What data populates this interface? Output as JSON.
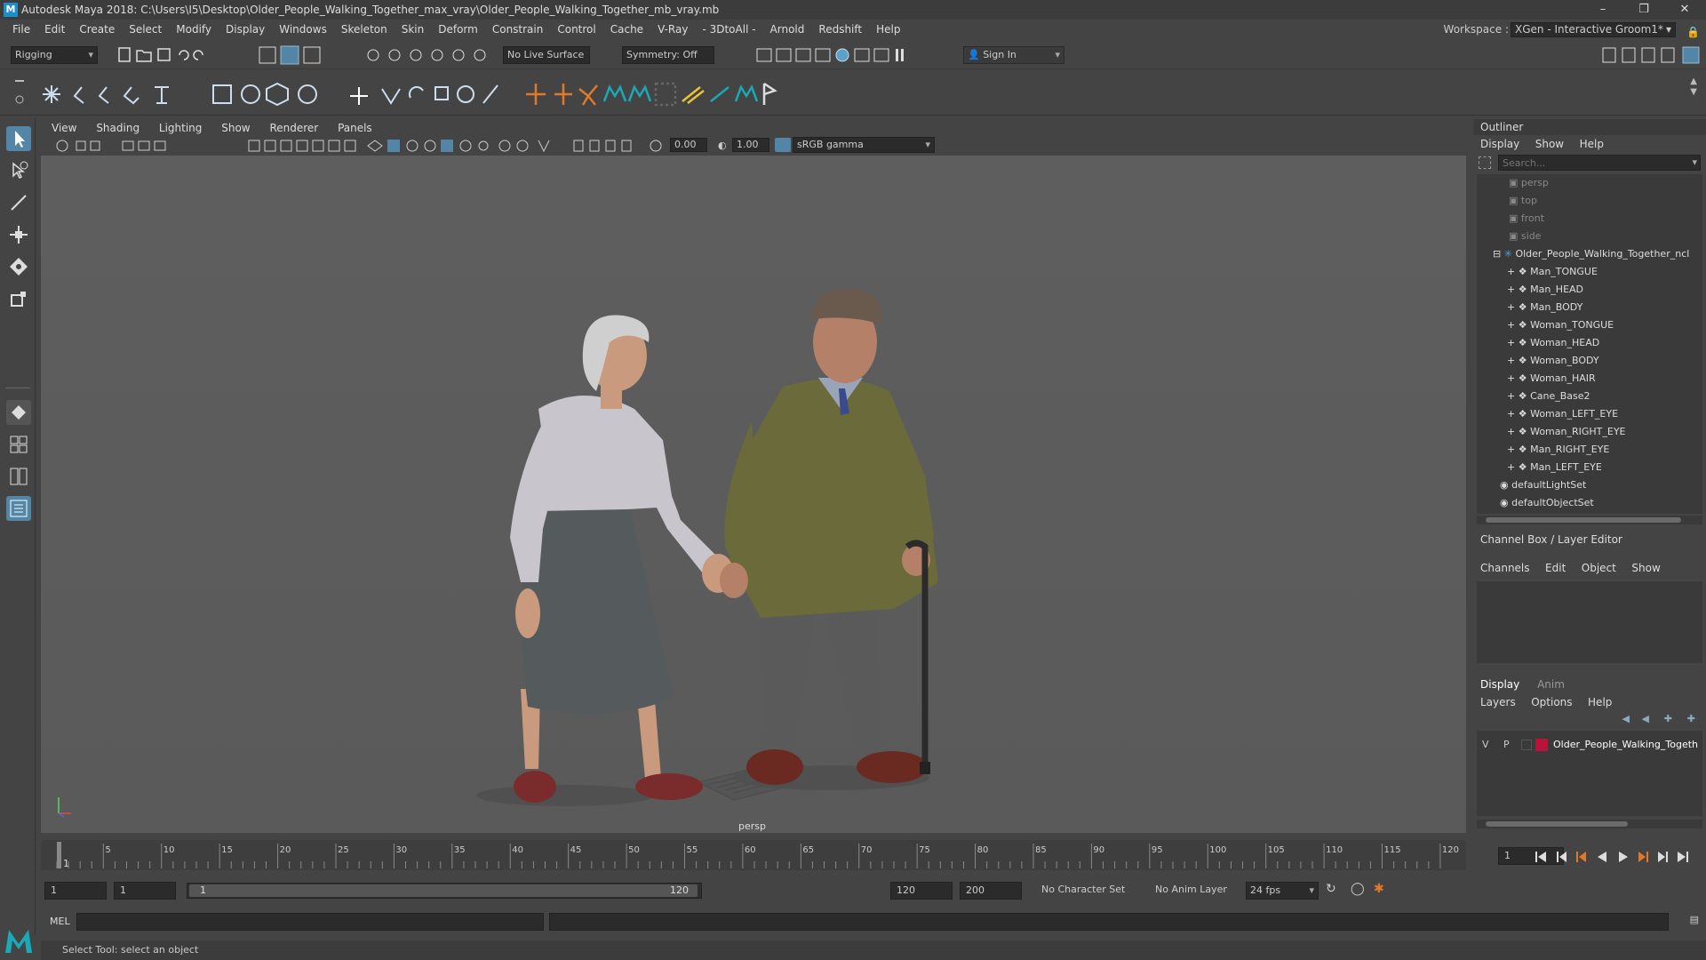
{
  "window": {
    "title": "Autodesk Maya 2018: C:\\Users\\I5\\Desktop\\Older_People_Walking_Together_max_vray\\Older_People_Walking_Together_mb_vray.mb",
    "logo": "M"
  },
  "menubar": {
    "items": [
      "File",
      "Edit",
      "Create",
      "Select",
      "Modify",
      "Display",
      "Windows",
      "Skeleton",
      "Skin",
      "Deform",
      "Constrain",
      "Control",
      "Cache",
      "V-Ray",
      "- 3DtoAll -",
      "Arnold",
      "Redshift",
      "Help"
    ],
    "workspace_label": "Workspace :",
    "workspace_value": "XGen - Interactive Groom1*"
  },
  "statusline": {
    "menuset": "Rigging",
    "live_surface": "No Live Surface",
    "symmetry": "Symmetry: Off",
    "sign_in": "Sign In"
  },
  "panel": {
    "menus": [
      "View",
      "Shading",
      "Lighting",
      "Show",
      "Renderer",
      "Panels"
    ],
    "exposure": "0.00",
    "gamma": "1.00",
    "colorspace": "sRGB gamma",
    "camera": "persp"
  },
  "outliner": {
    "title": "Outliner",
    "menus": [
      "Display",
      "Show",
      "Help"
    ],
    "search_placeholder": "Search...",
    "cameras": [
      "persp",
      "top",
      "front",
      "side"
    ],
    "group": "Older_People_Walking_Together_ncl",
    "children": [
      "Man_TONGUE",
      "Man_HEAD",
      "Man_BODY",
      "Woman_TONGUE",
      "Woman_HEAD",
      "Woman_BODY",
      "Woman_HAIR",
      "Cane_Base2",
      "Woman_LEFT_EYE",
      "Woman_RIGHT_EYE",
      "Man_RIGHT_EYE",
      "Man_LEFT_EYE"
    ],
    "sets": [
      "defaultLightSet",
      "defaultObjectSet"
    ]
  },
  "channelbox": {
    "title": "Channel Box / Layer Editor",
    "menus": [
      "Channels",
      "Edit",
      "Object",
      "Show"
    ]
  },
  "layereditor": {
    "tabs": [
      "Display",
      "Anim"
    ],
    "menus": [
      "Layers",
      "Options",
      "Help"
    ],
    "layer_v": "V",
    "layer_p": "P",
    "layer_name": "Older_People_Walking_Togeth",
    "layer_color": "#b8143a"
  },
  "timeslider": {
    "ticks": [
      "5",
      "10",
      "15",
      "20",
      "25",
      "30",
      "35",
      "40",
      "45",
      "50",
      "55",
      "60",
      "65",
      "70",
      "75",
      "80",
      "85",
      "90",
      "95",
      "100",
      "105",
      "110",
      "115",
      "120"
    ],
    "current_marker": "1",
    "current_frame": "1"
  },
  "rangeslider": {
    "start": "1",
    "playback_start": "1",
    "range_start": "1",
    "range_end": "120",
    "playback_end": "120",
    "end": "200",
    "character_set": "No Character Set",
    "anim_layer": "No Anim Layer",
    "fps": "24 fps"
  },
  "cmdline": {
    "label": "MEL"
  },
  "helpline": {
    "text": "Select Tool: select an object"
  },
  "colors": {
    "accent": "#5285a6",
    "maya_blue": "#1a8fc9",
    "shelf_teal": "#1aa9b8",
    "shelf_orange": "#e07a2a"
  }
}
